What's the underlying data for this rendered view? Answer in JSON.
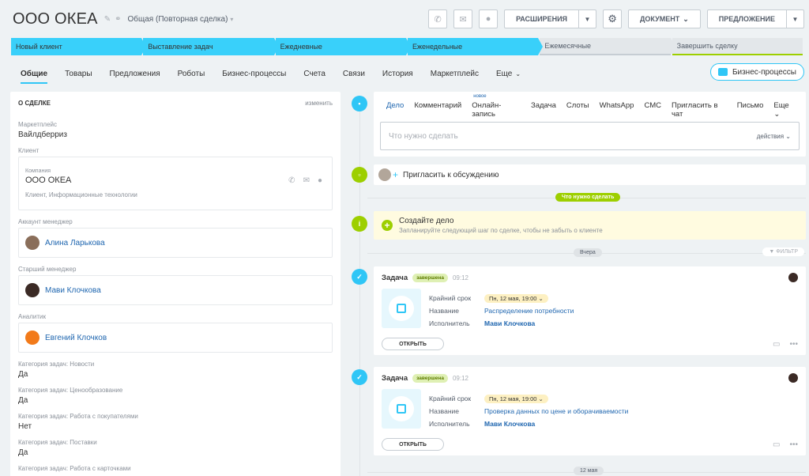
{
  "header": {
    "title": "ООО ОКЕА",
    "category": "Общая (Повторная сделка)",
    "extensions_label": "РАСШИРЕНИЯ",
    "document_label": "ДОКУМЕНТ",
    "offer_label": "ПРЕДЛОЖЕНИЕ"
  },
  "stages": [
    {
      "label": "Новый клиент",
      "state": "active"
    },
    {
      "label": "Выставление задач",
      "state": "active"
    },
    {
      "label": "Ежедневные",
      "state": "active"
    },
    {
      "label": "Еженедельные",
      "state": "active"
    },
    {
      "label": "Ежемесячные",
      "state": "inactive"
    },
    {
      "label": "Завершить сделку",
      "state": "inactive"
    }
  ],
  "tabs": [
    "Общие",
    "Товары",
    "Предложения",
    "Роботы",
    "Бизнес-процессы",
    "Счета",
    "Связи",
    "История",
    "Маркетплейс",
    "Еще"
  ],
  "bp_button": "Бизнес-процессы",
  "about": {
    "title": "О СДЕЛКЕ",
    "change": "изменить",
    "marketplace_label": "Маркетплейс",
    "marketplace_value": "Вайлдберриз",
    "client_label": "Клиент",
    "company_small": "Компания",
    "company_name": "ООО ОКЕА",
    "company_sub": "Клиент, Информационные технологии",
    "account_manager_label": "Аккаунт менеджер",
    "account_manager": "Алина Ларькова",
    "senior_manager_label": "Старший менеджер",
    "senior_manager": "Мави Клочкова",
    "analyst_label": "Аналитик",
    "analyst": "Евгений Клочков",
    "fields": [
      {
        "label": "Категория задач: Новости",
        "value": "Да"
      },
      {
        "label": "Категория задач: Ценообразование",
        "value": "Да"
      },
      {
        "label": "Категория задач: Работа с покупателями",
        "value": "Нет"
      },
      {
        "label": "Категория задач: Поставки",
        "value": "Да"
      },
      {
        "label": "Категория задач: Работа с карточками",
        "value": ""
      }
    ]
  },
  "activity": {
    "tabs": [
      "Дело",
      "Комментарий",
      "Онлайн-запись",
      "Задача",
      "Слоты",
      "WhatsApp",
      "СМС",
      "Пригласить в чат",
      "Письмо",
      "Еще"
    ],
    "new_badge": "новое",
    "placeholder": "Что нужно сделать",
    "actions": "действия"
  },
  "invite": "Пригласить к обсуждению",
  "todo_pill": "Что нужно сделать",
  "todo": {
    "title": "Создайте дело",
    "sub": "Запланируйте следующий шаг по сделке, чтобы не забыть о клиенте"
  },
  "yesterday": "Вчера",
  "filter": "ФИЛЬТР",
  "tasks": [
    {
      "title": "Задача",
      "status": "завершена",
      "time": "09:12",
      "deadline_label": "Крайний срок",
      "deadline": "Пн, 12 мая, 19:00",
      "name_label": "Название",
      "name": "Распределение потребности",
      "executor_label": "Исполнитель",
      "executor": "Мави Клочкова",
      "open": "ОТКРЫТЬ"
    },
    {
      "title": "Задача",
      "status": "завершена",
      "time": "09:12",
      "deadline_label": "Крайний срок",
      "deadline": "Пн, 12 мая, 19:00",
      "name_label": "Название",
      "name": "Проверка данных по цене и оборачиваемости",
      "executor_label": "Исполнитель",
      "executor": "Мави Клочкова",
      "open": "ОТКРЫТЬ"
    }
  ],
  "date_12may": "12 мая"
}
